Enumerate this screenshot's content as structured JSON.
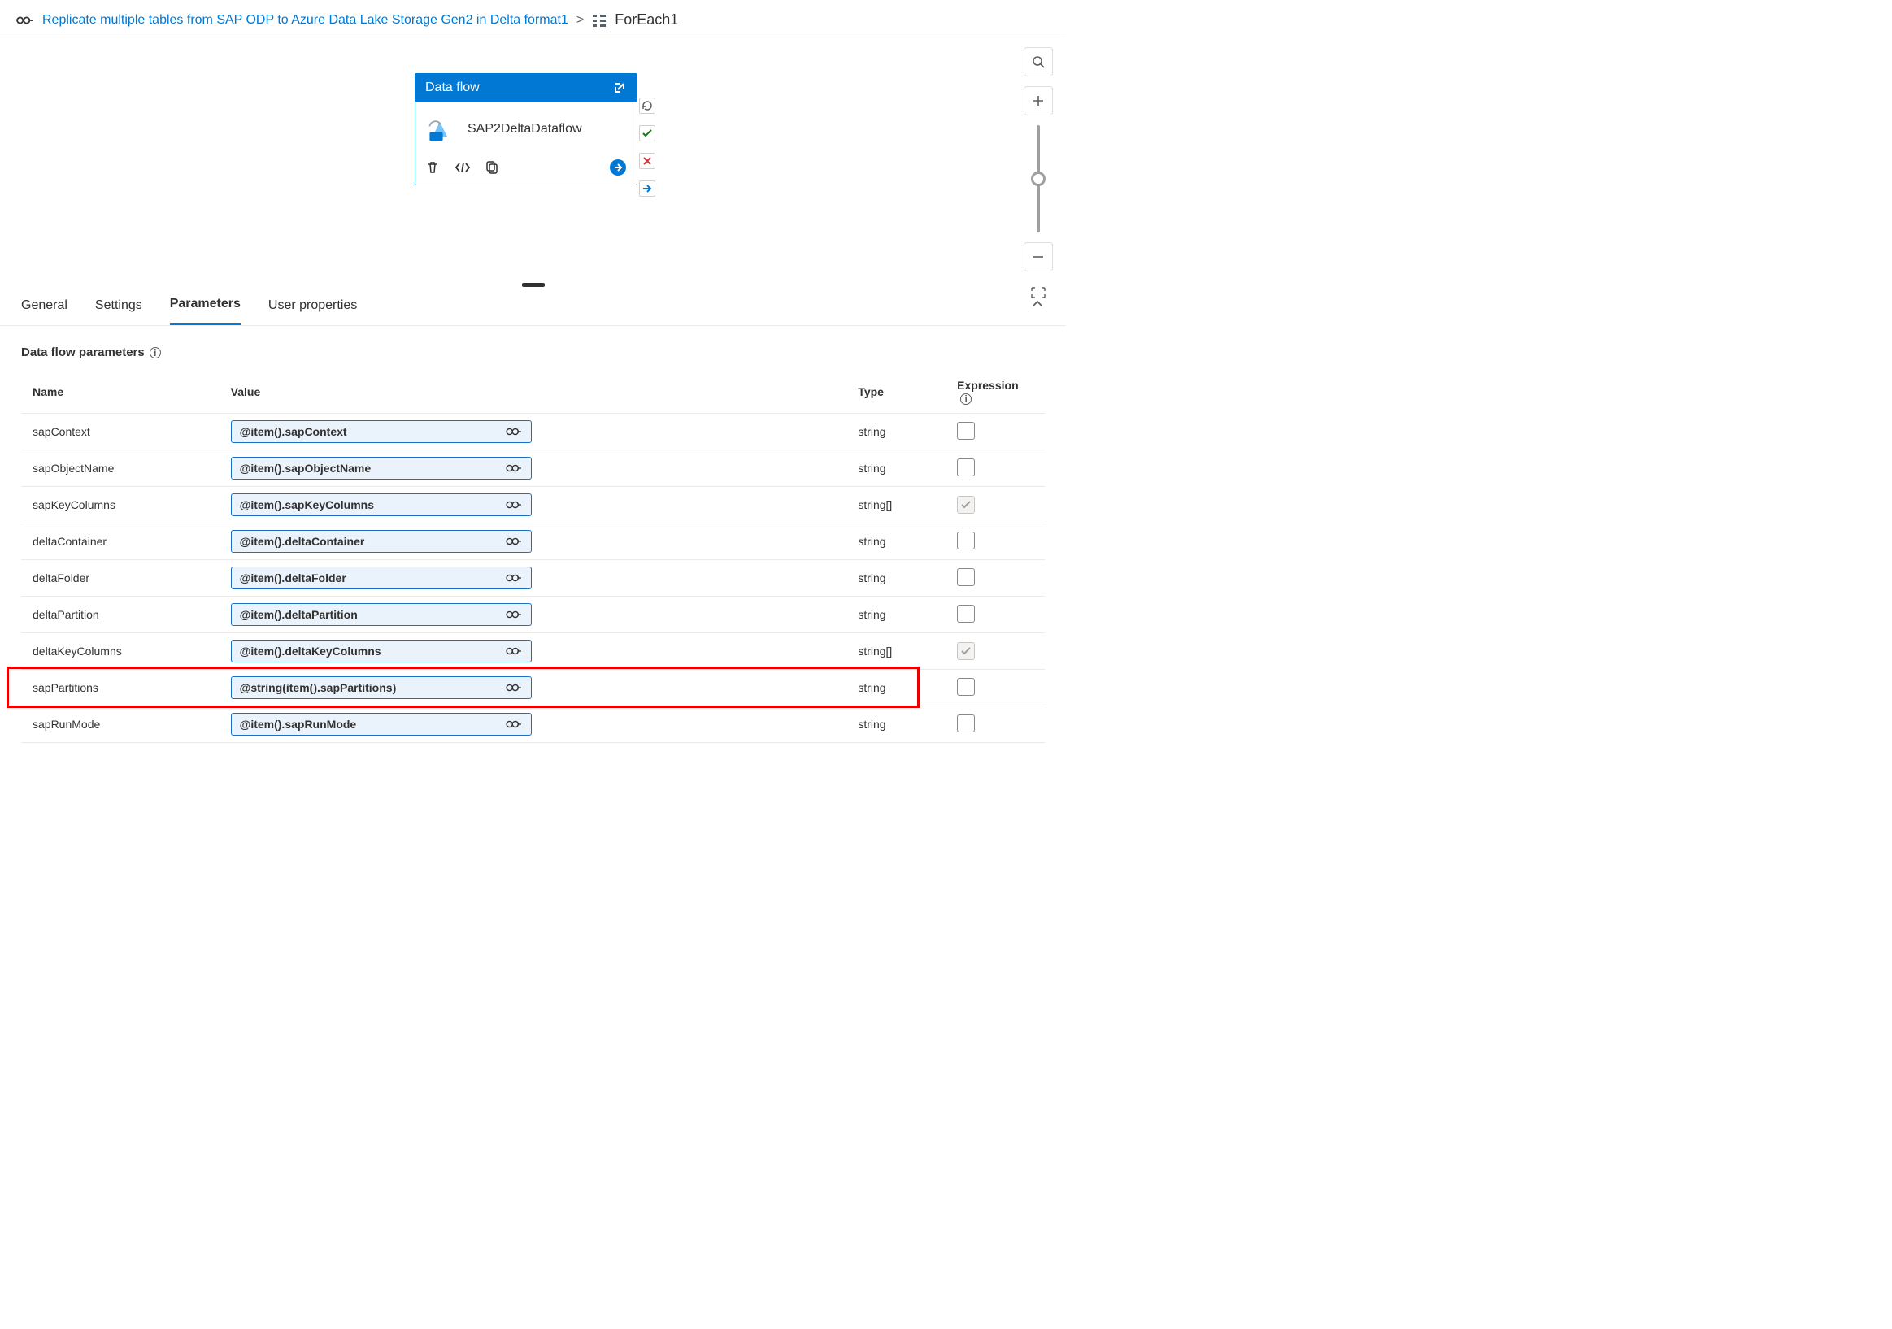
{
  "breadcrumb": {
    "link_text": "Replicate multiple tables from SAP ODP to Azure Data Lake Storage Gen2 in Delta format1",
    "separator": ">",
    "current": "ForEach1"
  },
  "activity": {
    "type_label": "Data flow",
    "name": "SAP2DeltaDataflow"
  },
  "tabs": {
    "items": [
      "General",
      "Settings",
      "Parameters",
      "User properties"
    ],
    "active_index": 2
  },
  "params": {
    "heading": "Data flow parameters",
    "columns": {
      "name": "Name",
      "value": "Value",
      "type": "Type",
      "expression": "Expression"
    },
    "rows": [
      {
        "name": "sapContext",
        "value": "@item().sapContext",
        "type": "string",
        "expr": "unchecked"
      },
      {
        "name": "sapObjectName",
        "value": "@item().sapObjectName",
        "type": "string",
        "expr": "unchecked"
      },
      {
        "name": "sapKeyColumns",
        "value": "@item().sapKeyColumns",
        "type": "string[]",
        "expr": "checked-disabled"
      },
      {
        "name": "deltaContainer",
        "value": "@item().deltaContainer",
        "type": "string",
        "expr": "unchecked"
      },
      {
        "name": "deltaFolder",
        "value": "@item().deltaFolder",
        "type": "string",
        "expr": "unchecked"
      },
      {
        "name": "deltaPartition",
        "value": "@item().deltaPartition",
        "type": "string",
        "expr": "unchecked"
      },
      {
        "name": "deltaKeyColumns",
        "value": "@item().deltaKeyColumns",
        "type": "string[]",
        "expr": "checked-disabled"
      },
      {
        "name": "sapPartitions",
        "value": "@string(item().sapPartitions)",
        "type": "string",
        "expr": "unchecked",
        "highlight": true
      },
      {
        "name": "sapRunMode",
        "value": "@item().sapRunMode",
        "type": "string",
        "expr": "unchecked"
      }
    ]
  }
}
